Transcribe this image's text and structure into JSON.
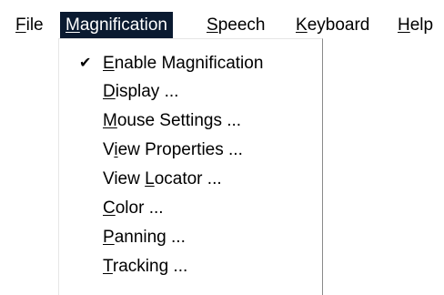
{
  "menubar": {
    "items": [
      {
        "pre": "",
        "key": "F",
        "post": "ile"
      },
      {
        "pre": "",
        "key": "M",
        "post": "agnification"
      },
      {
        "pre": "",
        "key": "S",
        "post": "peech"
      },
      {
        "pre": "",
        "key": "K",
        "post": "eyboard"
      },
      {
        "pre": "",
        "key": "H",
        "post": "elp"
      }
    ],
    "active_index": 1
  },
  "dropdown": {
    "items": [
      {
        "pre": "",
        "key": "E",
        "post": "nable Magnification",
        "checked": true
      },
      {
        "pre": "",
        "key": "D",
        "post": "isplay ..."
      },
      {
        "pre": "",
        "key": "M",
        "post": "ouse Settings ..."
      },
      {
        "pre": "V",
        "key": "i",
        "post": "ew Properties ..."
      },
      {
        "pre": "View ",
        "key": "L",
        "post": "ocator ..."
      },
      {
        "pre": "",
        "key": "C",
        "post": "olor ..."
      },
      {
        "pre": "",
        "key": "P",
        "post": "anning ..."
      },
      {
        "pre": "",
        "key": "T",
        "post": "racking ..."
      }
    ],
    "check_glyph": "✔",
    "check_icon": "checkmark-icon"
  },
  "colors": {
    "highlight": "#0a1a30",
    "highlight_text": "#ffffff"
  }
}
